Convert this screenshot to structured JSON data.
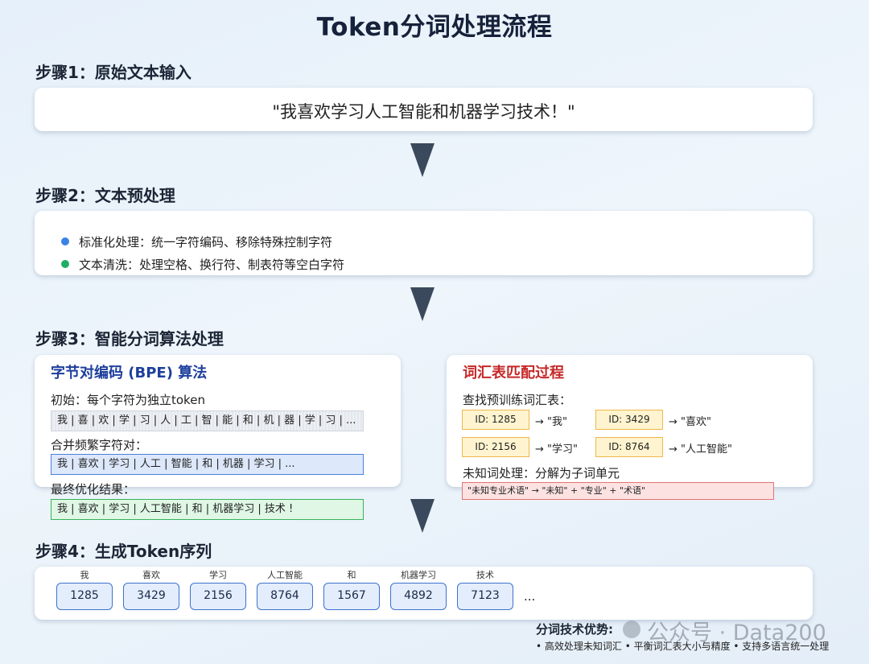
{
  "title": "Token分词处理流程",
  "step1": {
    "heading": "步骤1：原始文本输入",
    "text": "\"我喜欢学习人工智能和机器学习技术！\""
  },
  "step2": {
    "heading": "步骤2：文本预处理",
    "bullets": [
      {
        "text": "标准化处理：统一字符编码、移除特殊控制字符",
        "color": "#3b82e6"
      },
      {
        "text": "文本清洗：处理空格、换行符、制表符等空白字符",
        "color": "#1fae6a"
      }
    ]
  },
  "step3": {
    "heading": "步骤3：智能分词算法处理",
    "bpe": {
      "title": "字节对编码 (BPE) 算法",
      "initial_label": "初始：每个字符为独立token",
      "initial_row": "我 | 喜 | 欢 | 学 | 习 | 人 | 工 | 智 | 能 | 和 | 机 | 器 | 学 | 习 | ...",
      "merge_label": "合并频繁字符对：",
      "merge_row": "我 | 喜欢 | 学习 | 人工 | 智能 | 和 | 机器 | 学习 | ...",
      "final_label": "最终优化结果：",
      "final_row": "我 | 喜欢 | 学习 | 人工智能 | 和 | 机器学习 | 技术 !"
    },
    "vocab": {
      "title": "词汇表匹配过程",
      "lookup_label": "查找预训练词汇表：",
      "entries": [
        {
          "id": "ID: 1285",
          "map": "→ \"我\""
        },
        {
          "id": "ID: 3429",
          "map": "→ \"喜欢\""
        },
        {
          "id": "ID: 2156",
          "map": "→ \"学习\""
        },
        {
          "id": "ID: 8764",
          "map": "→ \"人工智能\""
        }
      ],
      "unknown_label": "未知词处理：分解为子词单元",
      "unknown_example": "\"未知专业术语\" → \"未知\" + \"专业\" + \"术语\""
    }
  },
  "step4": {
    "heading": "步骤4：生成Token序列",
    "tokens": [
      {
        "label": "我",
        "id": "1285"
      },
      {
        "label": "喜欢",
        "id": "3429"
      },
      {
        "label": "学习",
        "id": "2156"
      },
      {
        "label": "人工智能",
        "id": "8764"
      },
      {
        "label": "和",
        "id": "1567"
      },
      {
        "label": "机器学习",
        "id": "4892"
      },
      {
        "label": "技术",
        "id": "7123"
      }
    ],
    "ellipsis": "..."
  },
  "advantages": {
    "title": "分词技术优势:",
    "body": "• 高效处理未知词汇 • 平衡词汇表大小与精度 • 支持多语言统一处理"
  },
  "watermark": "公众号 · Data200"
}
